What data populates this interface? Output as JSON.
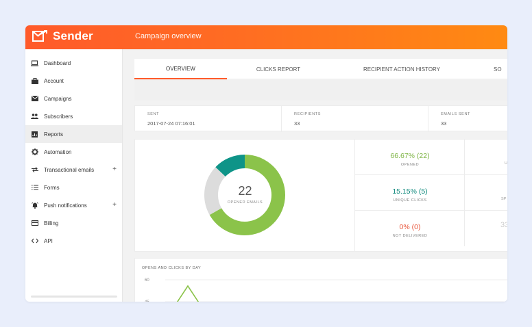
{
  "brand": {
    "name": "Sender",
    "color": "#ff6a22"
  },
  "header": {
    "title": "Campaign overview"
  },
  "sidebar": {
    "items": [
      {
        "label": "Dashboard",
        "icon": "laptop-icon"
      },
      {
        "label": "Account",
        "icon": "briefcase-icon"
      },
      {
        "label": "Campaigns",
        "icon": "envelope-icon"
      },
      {
        "label": "Subscribers",
        "icon": "people-icon"
      },
      {
        "label": "Reports",
        "icon": "report-icon",
        "active": true
      },
      {
        "label": "Automation",
        "icon": "gear-icon"
      },
      {
        "label": "Transactional emails",
        "icon": "swap-arrows-icon",
        "expandable": true
      },
      {
        "label": "Forms",
        "icon": "list-icon"
      },
      {
        "label": "Push notifications",
        "icon": "bell-icon",
        "expandable": true
      },
      {
        "label": "Billing",
        "icon": "credit-card-icon"
      },
      {
        "label": "API",
        "icon": "code-icon"
      }
    ],
    "expand_glyph": "+"
  },
  "tabs": [
    {
      "label": "OVERVIEW",
      "active": true
    },
    {
      "label": "CLICKS REPORT"
    },
    {
      "label": "RECIPIENT ACTION HISTORY"
    },
    {
      "label": "SO"
    }
  ],
  "stats": {
    "sent": {
      "label": "SENT",
      "value": "2017-07-24 07:16:01"
    },
    "recipients": {
      "label": "RECIPIENTS",
      "value": "33"
    },
    "emails_sent": {
      "label": "EMAILS SENT",
      "value": "33"
    }
  },
  "donut": {
    "value": "22",
    "label": "OPENED EMAILS",
    "segments": [
      {
        "fraction": 0.6667,
        "color": "#8bc34a"
      },
      {
        "fraction": 0.2033,
        "color": "#dcdcdc"
      },
      {
        "fraction": 0.13,
        "color": "#0e9488"
      }
    ]
  },
  "metrics": {
    "opened": {
      "value": "66.67% (22)",
      "label": "OPENED",
      "color": "#7cb342"
    },
    "unique_clicks": {
      "value": "15.15% (5)",
      "label": "UNIQUE CLICKS",
      "color": "#118a7e"
    },
    "not_delivered": {
      "value": "0% (0)",
      "label": "NOT DELIVERED",
      "color": "#e8553a"
    },
    "cut_right": [
      "U",
      "SP",
      "33"
    ]
  },
  "chart": {
    "title": "OPENS AND CLICKS BY DAY",
    "y_ticks": [
      "60",
      "45"
    ],
    "line_color": "#8bc34a"
  }
}
